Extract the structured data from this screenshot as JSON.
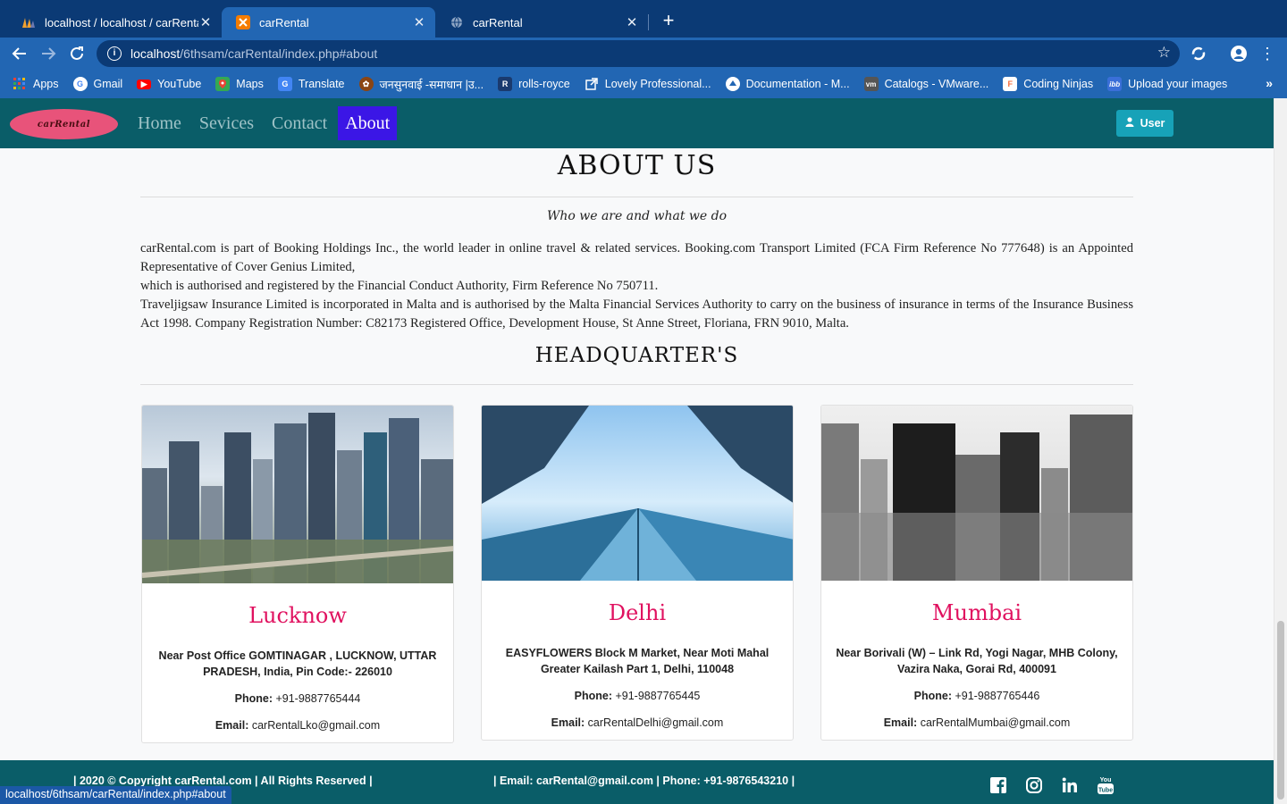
{
  "browser": {
    "tabs": [
      {
        "title": "localhost / localhost / carRental /",
        "active": false,
        "icon": "phpmyadmin-icon"
      },
      {
        "title": "carRental",
        "active": true,
        "icon": "xampp-icon"
      },
      {
        "title": "carRental",
        "active": false,
        "icon": "globe-icon"
      }
    ],
    "url_host": "localhost",
    "url_path": "/6thsam/carRental/index.php#about",
    "bookmarks": [
      {
        "label": "Apps",
        "icon": "apps-grid-icon",
        "color": "#4285f4"
      },
      {
        "label": "Gmail",
        "icon": "google-icon",
        "color": "#ffffff"
      },
      {
        "label": "YouTube",
        "icon": "youtube-icon",
        "color": "#ff0000"
      },
      {
        "label": "Maps",
        "icon": "maps-icon",
        "color": "#34a853"
      },
      {
        "label": "Translate",
        "icon": "translate-icon",
        "color": "#4285f4"
      },
      {
        "label": "जनसुनवाई -समाधान |उ...",
        "icon": "emblem-icon",
        "color": "#8b4513"
      },
      {
        "label": "rolls-royce",
        "icon": "rolls-royce-icon",
        "color": "#1a3a6e"
      },
      {
        "label": "Lovely Professional...",
        "icon": "external-link-icon",
        "color": "#2266b3"
      },
      {
        "label": "Documentation - M...",
        "icon": "docs-icon",
        "color": "#ffffff"
      },
      {
        "label": "Catalogs - VMware...",
        "icon": "vmware-icon",
        "color": "#555555"
      },
      {
        "label": "Coding Ninjas",
        "icon": "coding-ninjas-icon",
        "color": "#f66c3b"
      },
      {
        "label": "Upload your images",
        "icon": "ibb-icon",
        "color": "#3a6fd8"
      }
    ],
    "status_url": "localhost/6thsam/carRental/index.php#about"
  },
  "navbar": {
    "logo_text": "carRental",
    "links": [
      "Home",
      "Sevices",
      "Contact",
      "About"
    ],
    "active_link": "About",
    "user_button": "User"
  },
  "about": {
    "title": "ABOUT US",
    "subtitle": "Who we are and what we do",
    "paragraph_1": "carRental.com is part of Booking Holdings Inc., the world leader in online travel & related services. Booking.com Transport Limited (FCA Firm Reference No 777648) is an Appointed Representative of Cover Genius Limited,",
    "paragraph_2": "which is authorised and registered by the Financial Conduct Authority, Firm Reference No 750711.",
    "paragraph_3": "Traveljigsaw Insurance Limited is incorporated in Malta and is authorised by the Malta Financial Services Authority to carry on the business of insurance in terms of the Insurance Business Act 1998. Company Registration Number: C82173 Registered Office, Development House, St Anne Street, Floriana, FRN 9010, Malta."
  },
  "headquarters": {
    "title": "HEADQUARTER'S",
    "phone_label": "Phone:",
    "email_label": "Email:",
    "cards": [
      {
        "city": "Lucknow",
        "address": "Near Post Office GOMTINAGAR , LUCKNOW, UTTAR PRADESH, India, Pin Code:- 226010",
        "phone": "+91-9887765444",
        "email": "carRentalLko@gmail.com"
      },
      {
        "city": "Delhi",
        "address": "EASYFLOWERS Block M Market, Near Moti Mahal Greater Kailash Part 1, Delhi, 110048",
        "phone": "+91-9887765445",
        "email": "carRentalDelhi@gmail.com"
      },
      {
        "city": "Mumbai",
        "address": "Near Borivali (W) – Link Rd, Yogi Nagar, MHB Colony, Vazira Naka, Gorai Rd, 400091",
        "phone": "+91-9887765446",
        "email": "carRentalMumbai@gmail.com"
      }
    ]
  },
  "footer": {
    "copyright": "| 2020 © Copyright carRental.com | All Rights Reserved |",
    "contact": "| Email: carRental@gmail.com | Phone: +91-9876543210 |",
    "social": [
      "facebook-icon",
      "instagram-icon",
      "linkedin-icon",
      "youtube-icon"
    ]
  },
  "colors": {
    "navbar_bg": "#0a5d68",
    "active_link_bg": "#3b16e6",
    "city_color": "#e0115f",
    "user_button_bg": "#17a2b8"
  }
}
